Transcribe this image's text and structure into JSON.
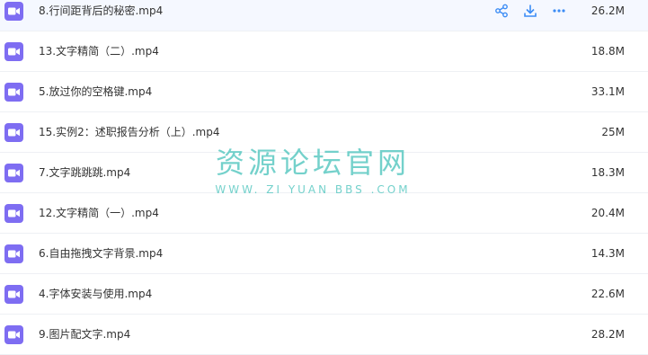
{
  "files": [
    {
      "name": "8.行间距背后的秘密.mp4",
      "size": "26.2M"
    },
    {
      "name": "13.文字精简（二）.mp4",
      "size": "18.8M"
    },
    {
      "name": "5.放过你的空格键.mp4",
      "size": "33.1M"
    },
    {
      "name": "15.实例2：述职报告分析（上）.mp4",
      "size": "25M"
    },
    {
      "name": "7.文字跳跳跳.mp4",
      "size": "18.3M"
    },
    {
      "name": "12.文字精简（一）.mp4",
      "size": "20.4M"
    },
    {
      "name": "6.自由拖拽文字背景.mp4",
      "size": "14.3M"
    },
    {
      "name": "4.字体安装与使用.mp4",
      "size": "22.6M"
    },
    {
      "name": "9.图片配文字.mp4",
      "size": "28.2M"
    }
  ],
  "row_actions": [
    "share-icon",
    "download-icon",
    "more-icon"
  ],
  "watermark": {
    "title": "资源论坛官网",
    "subtitle": "WWW. ZI YUAN BBS .COM"
  },
  "colors": {
    "file_icon": "#7e6df2",
    "action_icon": "#3b8cf5",
    "watermark": "#5cc9c3",
    "hover_row": "#f5f8ff"
  }
}
